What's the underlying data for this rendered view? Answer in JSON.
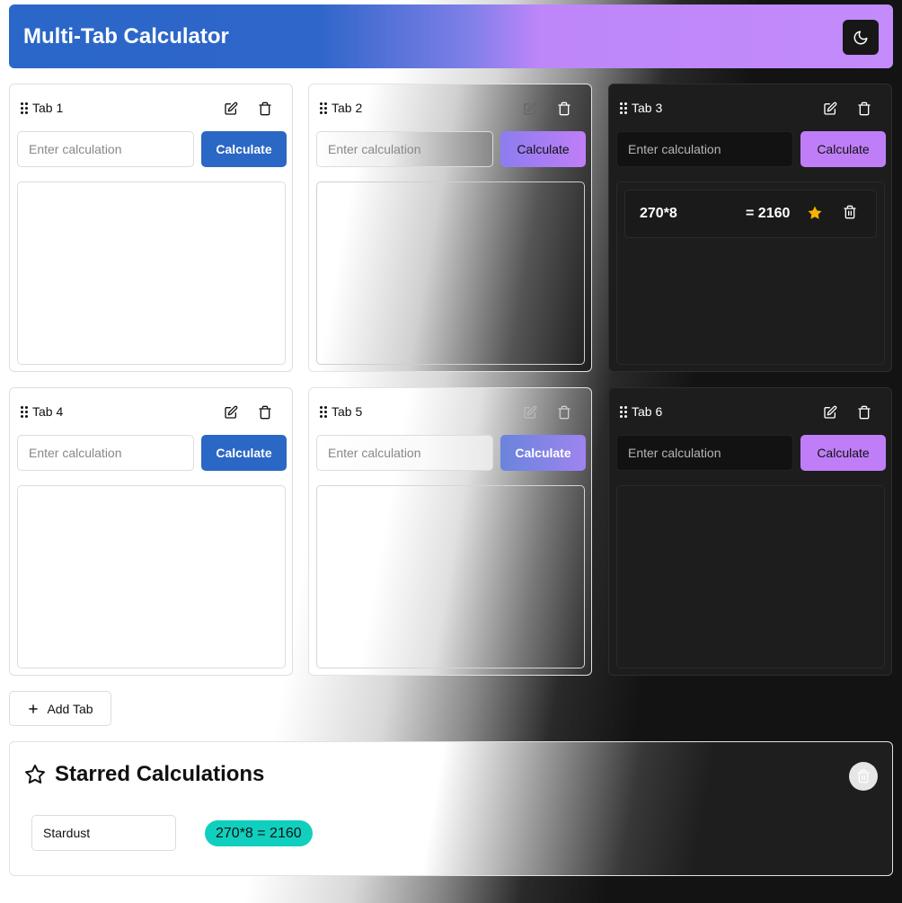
{
  "app": {
    "title": "Multi-Tab Calculator",
    "theme_toggle_icon": "moon-icon"
  },
  "tabs": [
    {
      "label": "Tab 1",
      "placeholder": "Enter calculation",
      "button": "Calculate"
    },
    {
      "label": "Tab 2",
      "placeholder": "Enter calculation",
      "button": "Calculate"
    },
    {
      "label": "Tab 3",
      "placeholder": "Enter calculation",
      "button": "Calculate",
      "history": [
        {
          "expression": "270*8",
          "result": "= 2160",
          "starred": true
        }
      ]
    },
    {
      "label": "Tab 4",
      "placeholder": "Enter calculation",
      "button": "Calculate"
    },
    {
      "label": "Tab 5",
      "placeholder": "Enter calculation",
      "button": "Calculate"
    },
    {
      "label": "Tab 6",
      "placeholder": "Enter calculation",
      "button": "Calculate"
    }
  ],
  "add_tab": {
    "label": "Add Tab"
  },
  "starred": {
    "title": "Starred Calculations",
    "name_value": "Stardust",
    "items": [
      {
        "text": "270*8 = 2160"
      }
    ]
  },
  "colors": {
    "primary_blue": "#2b67c5",
    "accent_purple": "#bf7ef7",
    "star_yellow": "#f5b301",
    "chip_teal": "#10cfbe"
  }
}
